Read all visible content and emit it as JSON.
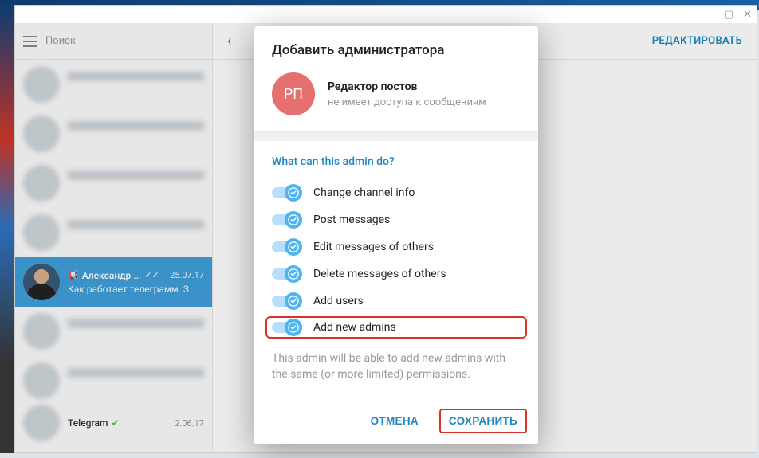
{
  "titlebar": {
    "min": "—",
    "max": "▢",
    "close": "✕"
  },
  "search": {
    "placeholder": "Поиск"
  },
  "right": {
    "edit_label": "РЕДАКТИРОВАТЬ"
  },
  "selected_chat": {
    "name": "Александр ...",
    "date": "25.07.17",
    "preview": "Как работает телеграмм. З..."
  },
  "footer_chat": {
    "name": "Telegram",
    "date": "2.06.17"
  },
  "modal": {
    "title": "Добавить администратора",
    "admin": {
      "initials": "РП",
      "name": "Редактор постов",
      "subtitle": "не имеет доступа к сообщениям"
    },
    "section_title": "What can this admin do?",
    "permissions": [
      {
        "label": "Change channel info",
        "on": true,
        "highlight": false
      },
      {
        "label": "Post messages",
        "on": true,
        "highlight": false
      },
      {
        "label": "Edit messages of others",
        "on": true,
        "highlight": false
      },
      {
        "label": "Delete messages of others",
        "on": true,
        "highlight": false
      },
      {
        "label": "Add users",
        "on": true,
        "highlight": false
      },
      {
        "label": "Add new admins",
        "on": true,
        "highlight": true
      }
    ],
    "note": "This admin will be able to add new admins with the same (or more limited) permissions.",
    "cancel_label": "ОТМЕНА",
    "save_label": "СОХРАНИТЬ"
  }
}
